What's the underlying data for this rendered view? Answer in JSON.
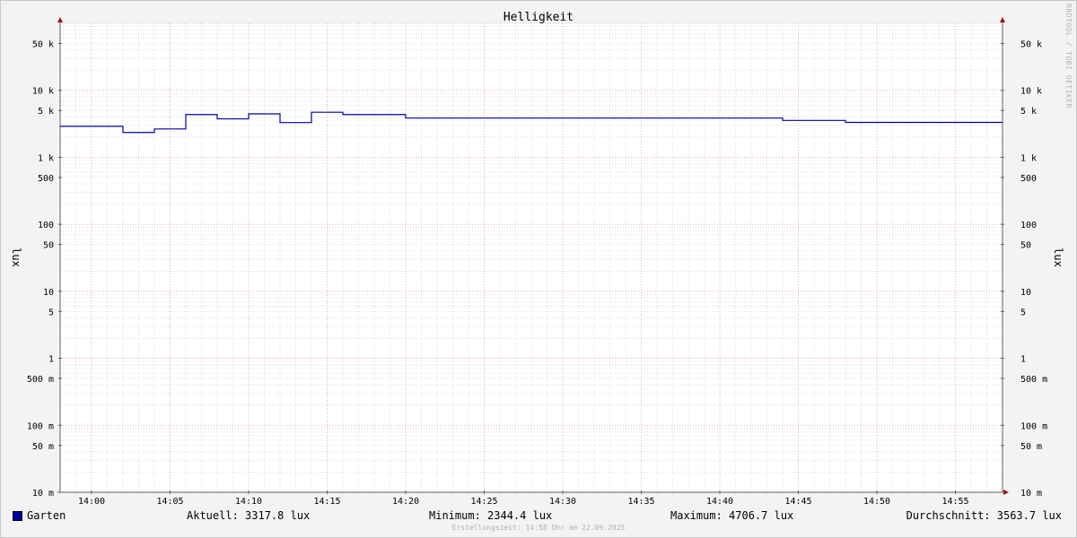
{
  "chart_data": {
    "type": "line",
    "title": "Helligkeit",
    "ylabel": "lux",
    "ylabel_right": "lux",
    "yscale": "log",
    "ylim": [
      0.01,
      100000
    ],
    "y_ticks": [
      {
        "value": 50000,
        "label": "50 k"
      },
      {
        "value": 10000,
        "label": "10 k"
      },
      {
        "value": 5000,
        "label": "5 k"
      },
      {
        "value": 1000,
        "label": "1 k"
      },
      {
        "value": 500,
        "label": "500"
      },
      {
        "value": 100,
        "label": "100"
      },
      {
        "value": 50,
        "label": "50"
      },
      {
        "value": 10,
        "label": "10"
      },
      {
        "value": 5,
        "label": "5"
      },
      {
        "value": 1,
        "label": "1"
      },
      {
        "value": 0.5,
        "label": "500 m"
      },
      {
        "value": 0.1,
        "label": "100 m"
      },
      {
        "value": 0.05,
        "label": "50 m"
      },
      {
        "value": 0.01,
        "label": "10 m"
      }
    ],
    "x_ticks": [
      "14:00",
      "14:05",
      "14:10",
      "14:15",
      "14:20",
      "14:25",
      "14:30",
      "14:35",
      "14:40",
      "14:45",
      "14:50",
      "14:55"
    ],
    "xlim": [
      "13:58",
      "14:58"
    ],
    "grid": true,
    "series": [
      {
        "name": "Garten",
        "color": "#0000a0",
        "x": [
          "13:58",
          "14:02",
          "14:04",
          "14:06",
          "14:08",
          "14:10",
          "14:12",
          "14:14",
          "14:16",
          "14:20",
          "14:44",
          "14:48",
          "14:58"
        ],
        "values": [
          2900,
          2344.4,
          2650,
          4350,
          3750,
          4450,
          3300,
          4706.7,
          4350,
          3850,
          3550,
          3317.8,
          3317.8
        ]
      }
    ]
  },
  "legend": {
    "series_name": "Garten",
    "current": "Aktuell: 3317.8 lux",
    "minimum": "Minimum: 2344.4 lux",
    "maximum": "Maximum: 4706.7 lux",
    "average": "Durchschnitt: 3563.7 lux"
  },
  "footer": "Erstellungszeit: 14:58 Uhr am 22.09.2025",
  "watermark": "RRDTOOL / TOBI OETIKER",
  "colors": {
    "background": "#f3f3f3",
    "plot_area": "#ffffff",
    "major_grid": "#e8a0a0",
    "minor_grid": "#d8d8d8",
    "axis_arrow": "#a01010",
    "series": "#0000a0"
  }
}
